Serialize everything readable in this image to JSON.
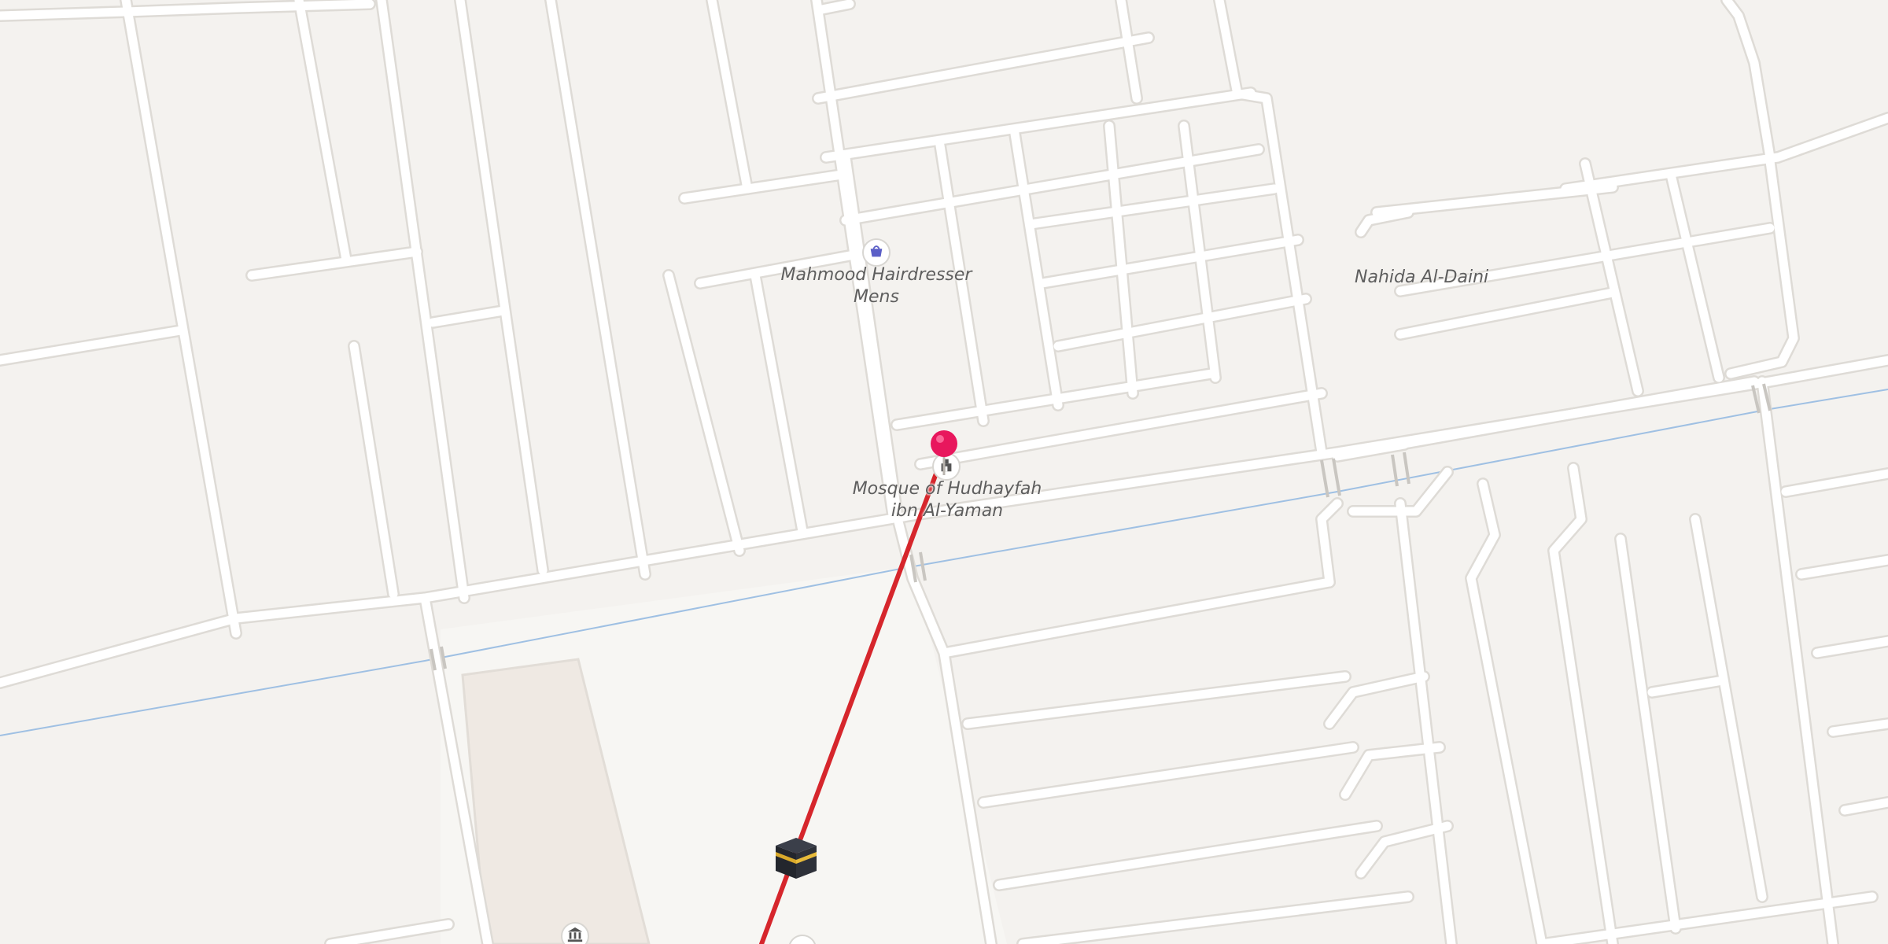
{
  "map": {
    "colors": {
      "background": "#f4f2ef",
      "road": "#ffffff",
      "road_edge": "#dcdad6",
      "block": "#f3f1ee",
      "lot": "#efe9e3",
      "route_line": "#d6262c",
      "pin": "#e8175d",
      "waterway": "#8fb4de",
      "poi_shop": "#5b5fc7",
      "poi_worship": "#555555"
    },
    "labels": {
      "hairdresser": "Mahmood Hairdresser Mens",
      "mosque": "Mosque of Hudhayfah ibn Al-Yaman",
      "nahida": "Nahida Al-Daini"
    },
    "icons": {
      "hairdresser": "shopping-basket-icon",
      "mosque": "mosque-icon",
      "museum": "museum-icon",
      "destination": "location-pin-icon",
      "qibla": "kaaba-icon"
    }
  }
}
